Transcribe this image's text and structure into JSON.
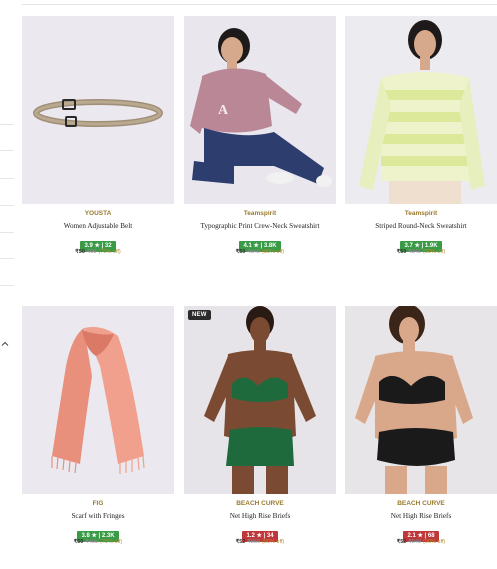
{
  "colors": {
    "rating_green": "#3a9b47",
    "rating_red": "#c0373a",
    "brand_gold": "#9a7a2e"
  },
  "products": [
    {
      "brand": "YOUSTA",
      "name": "Women Adjustable Belt",
      "rating_text": "3.9 ★ | 32",
      "rating_color": "green",
      "price": "₹50",
      "mrp": "₹99",
      "discount": "(70% off)",
      "badge": ""
    },
    {
      "brand": "Teamspirit",
      "name": "Typographic Print Crew-Neck Sweatshirt",
      "rating_text": "4.1 ★ | 3.8K",
      "rating_color": "green",
      "price": "₹50",
      "mrp": "₹849",
      "discount": "(80% off)",
      "badge": ""
    },
    {
      "brand": "Teamspirit",
      "name": "Striped Round-Neck Sweatshirt",
      "rating_text": "3.7 ★ | 1.9K",
      "rating_color": "green",
      "price": "₹50",
      "mrp": "₹849",
      "discount": "(80% off)",
      "badge": ""
    },
    {
      "brand": "FIG",
      "name": "Scarf with Fringes",
      "rating_text": "3.8 ★ | 2.3K",
      "rating_color": "green",
      "price": "₹50",
      "mrp": "₹499",
      "discount": "(75% off)",
      "badge": ""
    },
    {
      "brand": "BEACH CURVE",
      "name": "Net High Rise Briefs",
      "rating_text": "1.2 ★ | 34",
      "rating_color": "red",
      "price": "₹52",
      "mrp": "₹860",
      "discount": "(90% off)",
      "badge": "NEW"
    },
    {
      "brand": "BEACH CURVE",
      "name": "Net High Rise Briefs",
      "rating_text": "2.1 ★ | 68",
      "rating_color": "red",
      "price": "₹52",
      "mrp": "₹849",
      "discount": "(90% off)",
      "badge": ""
    }
  ]
}
